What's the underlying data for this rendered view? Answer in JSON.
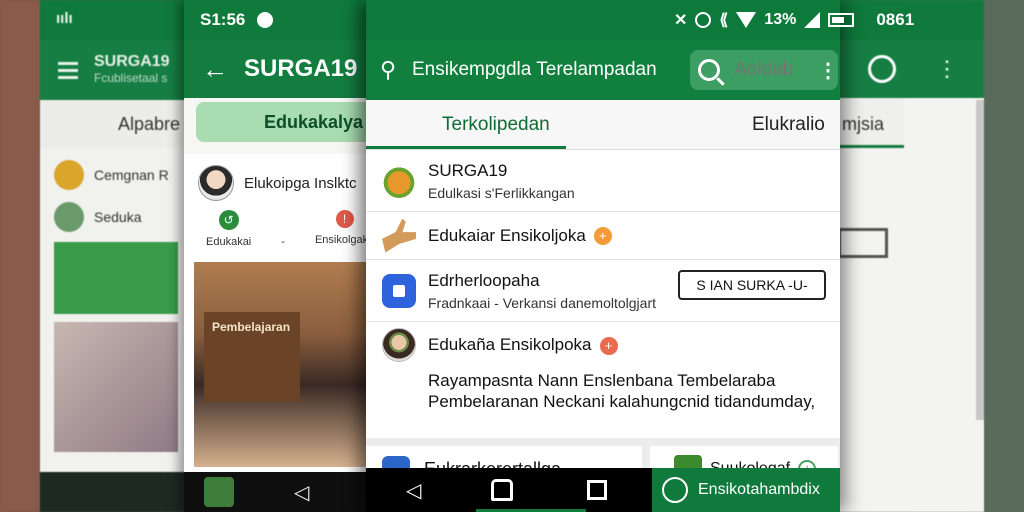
{
  "phone_left": {
    "status": "ıılı",
    "app_title": "SURGA19",
    "app_subtitle": "Fcublisetaal s",
    "tab": "Alpabre",
    "row1": "Cemgnan R",
    "row2": "Seduka"
  },
  "phone_mid": {
    "status_time": "S1:56",
    "app_title": "SURGA19",
    "tab": "Edukakalya",
    "profile_name": "Elukoipga Inslktc",
    "action_1": "Edukakai",
    "action_sep": "-",
    "action_2": "Ensikolgaka",
    "photo_sign": "Pembelajaran"
  },
  "phone_front": {
    "app_title": "Ensikempgdla Terelampadan",
    "search_placeholder": "Aoldab",
    "tab_active": "Terkolipedan",
    "tab_other": "Elukralio",
    "rows": [
      {
        "title": "SURGA19",
        "subtitle": "Edulkasi s'Ferlikkangan"
      },
      {
        "title": "Edukaiar Ensikoljoka",
        "badge": "+"
      },
      {
        "title": "Edrherloopaha",
        "subtitle": "Fradnkaai - Verkansi danemoltolgjart",
        "button": "S IAN SURKA -U-"
      },
      {
        "title": "Edukaña Ensikolpoka",
        "badge": "+"
      }
    ],
    "description_line1": "Rayampasnta Nann Enslenbana Tembelaraba",
    "description_line2": "Pembelaranan Neckani kalahungcnid tidandumday,",
    "card_left": "Eukrarkerertallga",
    "card_right": "Suukolegaf",
    "card_right_plus": "+",
    "nav_pill_label": "Ensikotahambdix"
  },
  "phone_right": {
    "tab": "mjsia"
  },
  "statusbar": {
    "time": "0861",
    "battery": "13%"
  },
  "colors": {
    "primary_green": "#11803f",
    "status_green": "#0d7a3c",
    "tab_highlight": "#a9dcb0",
    "badge_orange": "#f29c38",
    "badge_red": "#ea6a4f",
    "icon_blue": "#2f63db"
  },
  "icons": [
    "menu-icon",
    "back-arrow-icon",
    "search-icon",
    "more-vert-icon",
    "alarm-icon",
    "wifi-icon",
    "signal-icon",
    "battery-icon",
    "back-nav-icon",
    "home-nav-icon",
    "recents-nav-icon"
  ]
}
